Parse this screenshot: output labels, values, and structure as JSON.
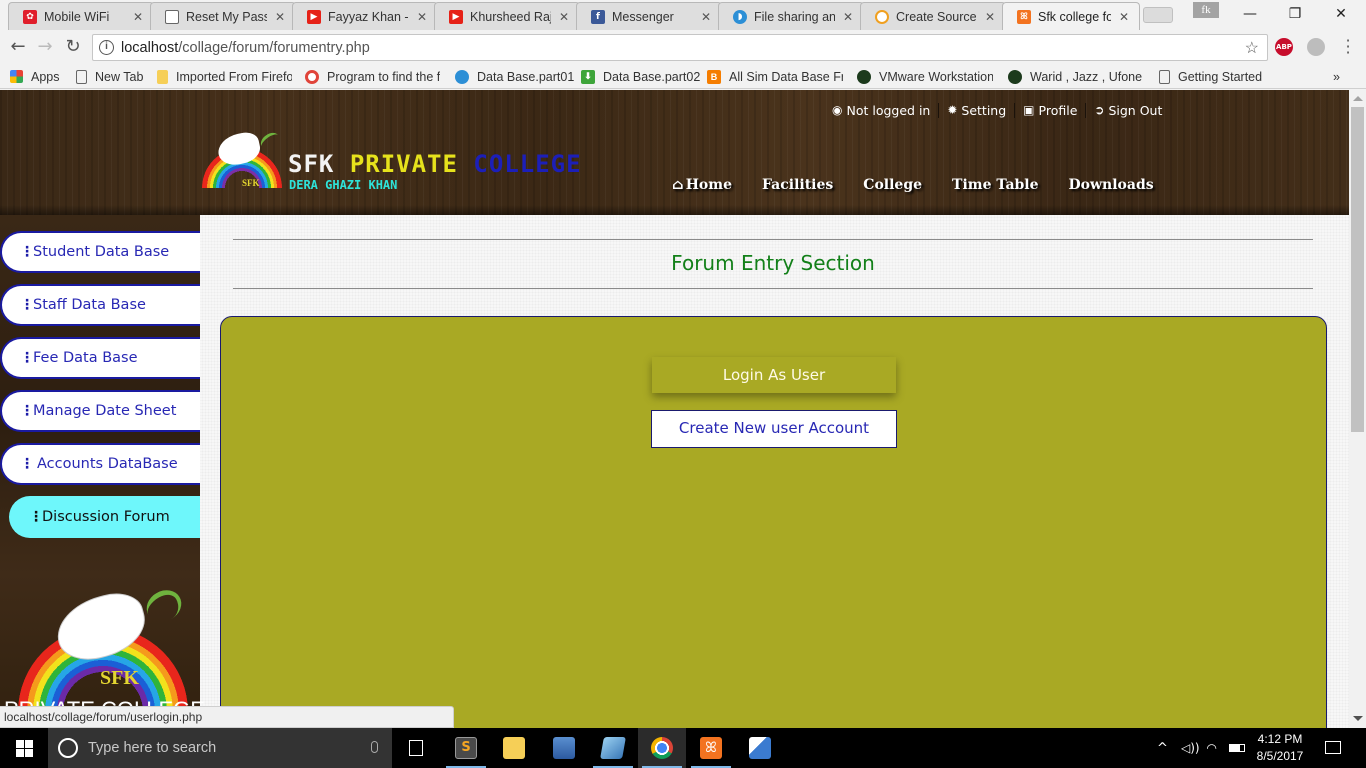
{
  "browser": {
    "tabs": [
      {
        "label": "Mobile WiFi",
        "icon": "huawei-icon",
        "color": "#e01e2b",
        "active": false
      },
      {
        "label": "Reset My Passw",
        "icon": "page-icon",
        "color": "#ffffff",
        "active": false
      },
      {
        "label": "Fayyaz Khan - Y",
        "icon": "youtube-icon",
        "color": "#e62117",
        "active": false
      },
      {
        "label": "Khursheed Rajp",
        "icon": "youtube-icon",
        "color": "#e62117",
        "active": false
      },
      {
        "label": "Messenger",
        "icon": "facebook-icon",
        "color": "#3b5998",
        "active": false
      },
      {
        "label": "File sharing and",
        "icon": "cloud-icon",
        "color": "#2c8fd6",
        "active": false
      },
      {
        "label": "Create Source C",
        "icon": "source-icon",
        "color": "#f0a020",
        "active": false
      },
      {
        "label": "Sfk college foru",
        "icon": "xampp-icon",
        "color": "#f37320",
        "active": true
      }
    ],
    "profile_chip": "fk",
    "window_controls": {
      "minimize": "—",
      "restore": "❐",
      "close": "✕"
    },
    "address": {
      "host": "localhost",
      "path": "/collage/forum/forumentry.php"
    },
    "extensions": [
      {
        "name": "ABP",
        "color": "#c70d2c"
      }
    ],
    "bookmarks": [
      {
        "label": "Apps",
        "icon": "apps-grid-icon"
      },
      {
        "label": "New Tab",
        "icon": "page-icon"
      },
      {
        "label": "Imported From Firefo",
        "icon": "folder-icon"
      },
      {
        "label": "Program to find the f",
        "icon": "target-icon"
      },
      {
        "label": "Data Base.part01",
        "icon": "cloud-icon"
      },
      {
        "label": "Data Base.part02",
        "icon": "download-icon"
      },
      {
        "label": "All Sim Data Base Fre",
        "icon": "blogger-icon"
      },
      {
        "label": "VMware Workstation",
        "icon": "android-icon"
      },
      {
        "label": "Warid , Jazz , Ufone ,",
        "icon": "android-icon"
      },
      {
        "label": "Getting Started",
        "icon": "page-icon"
      }
    ],
    "bookmarks_overflow": "»",
    "status_url": "localhost/collage/forum/userlogin.php"
  },
  "site": {
    "top_links": [
      {
        "label": "Not logged in",
        "icon": "user-circle-icon",
        "glyph": "◉"
      },
      {
        "label": "Setting",
        "icon": "gear-icon",
        "glyph": "✹"
      },
      {
        "label": "Profile",
        "icon": "profile-card-icon",
        "glyph": "▣"
      },
      {
        "label": "Sign Out",
        "icon": "sign-out-icon",
        "glyph": "➲"
      }
    ],
    "logo": {
      "title_w1": "SFK",
      "title_w2": "PRIVATE",
      "title_w3": "COLLEGE",
      "subtitle": "DERA GHAZI KHAN",
      "badge": "SFK",
      "colors": {
        "w1": "#f3f3f3",
        "w2": "#e6e21c",
        "w3": "#1c1fb8",
        "subtitle": "#2ee3d9"
      }
    },
    "nav": [
      {
        "label": "Home",
        "icon": "home-icon",
        "glyph": "⌂"
      },
      {
        "label": "Facilities"
      },
      {
        "label": "College"
      },
      {
        "label": "Time Table"
      },
      {
        "label": "Downloads"
      }
    ],
    "sidebar": {
      "items": [
        {
          "label": "Student Data Base",
          "active": false
        },
        {
          "label": "Staff Data Base",
          "active": false
        },
        {
          "label": "Fee Data Base",
          "active": false
        },
        {
          "label": "Manage Date Sheet",
          "active": false
        },
        {
          "label": "Accounts DataBase",
          "active": false
        },
        {
          "label": "Discussion Forum",
          "active": true
        }
      ],
      "kebab_glyph": "⋮",
      "logo_badge": "SFK",
      "logo_caption": "PRIVATE COLLEGE"
    },
    "main": {
      "section_title": "Forum Entry Section",
      "login_button": "Login As User",
      "create_button": "Create New user Account",
      "colors": {
        "panel": "#a9a924",
        "title": "#138019",
        "link": "#2828b4"
      }
    }
  },
  "taskbar": {
    "search_placeholder": "Type here to search",
    "apps": [
      {
        "name": "task-view-icon",
        "running": false
      },
      {
        "name": "sublime-text-icon",
        "running": true
      },
      {
        "name": "file-explorer-icon",
        "running": false
      },
      {
        "name": "network-computer-icon",
        "running": false
      },
      {
        "name": "notepad-icon",
        "running": true
      },
      {
        "name": "chrome-icon",
        "running": true,
        "active": true
      },
      {
        "name": "xampp-icon",
        "running": true
      },
      {
        "name": "visual-studio-icon",
        "running": false
      }
    ],
    "tray": {
      "chevron": "^",
      "volume": "🔊",
      "wifi": "wifi",
      "battery": "battery"
    },
    "time": "4:12 PM",
    "date": "8/5/2017"
  }
}
